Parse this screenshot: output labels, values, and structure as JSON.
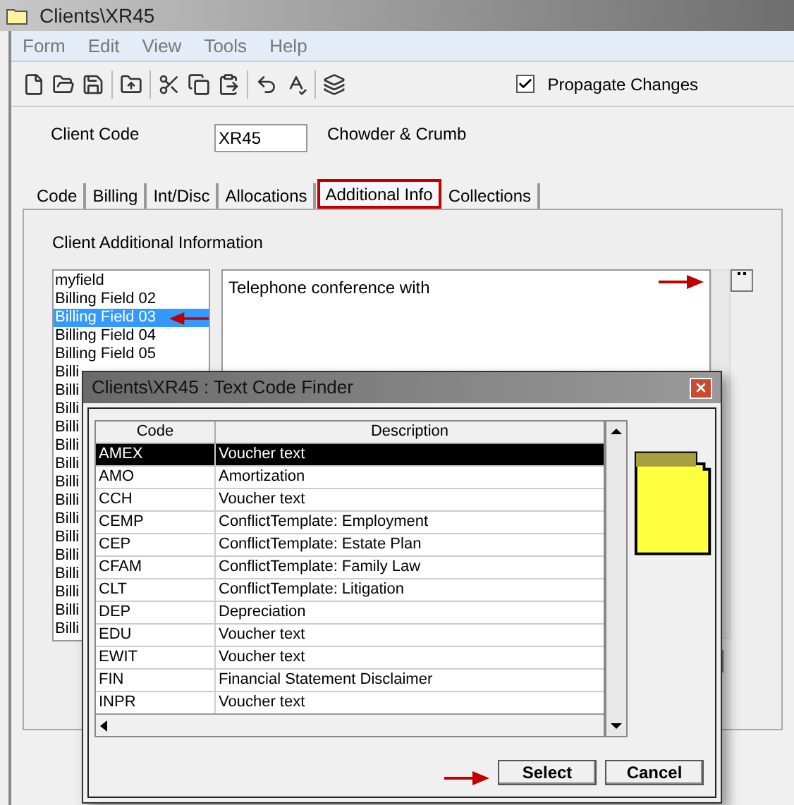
{
  "window": {
    "title": "Clients\\XR45"
  },
  "menu": [
    "Form",
    "Edit",
    "View",
    "Tools",
    "Help"
  ],
  "propagate": {
    "label": "Propagate Changes",
    "checked": true
  },
  "client": {
    "label": "Client Code",
    "code": "XR45",
    "name": "Chowder & Crumb"
  },
  "tabs": [
    {
      "label": "Code",
      "selected": false,
      "highlighted": false
    },
    {
      "label": "Billing",
      "selected": false,
      "highlighted": false
    },
    {
      "label": "Int/Disc",
      "selected": false,
      "highlighted": false
    },
    {
      "label": "Allocations",
      "selected": false,
      "highlighted": false
    },
    {
      "label": "Additional Info",
      "selected": true,
      "highlighted": true
    },
    {
      "label": "Collections",
      "selected": false,
      "highlighted": false
    }
  ],
  "section_title": "Client Additional Information",
  "fields": [
    {
      "label": "myfield",
      "selected": false
    },
    {
      "label": "Billing Field 02",
      "selected": false
    },
    {
      "label": "Billing Field 03",
      "selected": true
    },
    {
      "label": "Billing Field 04",
      "selected": false
    },
    {
      "label": "Billing Field 05",
      "selected": false
    },
    {
      "label": "Billi",
      "selected": false
    },
    {
      "label": "Billi",
      "selected": false
    },
    {
      "label": "Billi",
      "selected": false
    },
    {
      "label": "Billi",
      "selected": false
    },
    {
      "label": "Billi",
      "selected": false
    },
    {
      "label": "Billi",
      "selected": false
    },
    {
      "label": "Billi",
      "selected": false
    },
    {
      "label": "Billi",
      "selected": false
    },
    {
      "label": "Billi",
      "selected": false
    },
    {
      "label": "Billi",
      "selected": false
    },
    {
      "label": "Billi",
      "selected": false
    },
    {
      "label": "Billi",
      "selected": false
    },
    {
      "label": "Billi",
      "selected": false
    },
    {
      "label": "Billi",
      "selected": false
    },
    {
      "label": "Billi",
      "selected": false
    }
  ],
  "field_value": "Telephone conference with",
  "dialog": {
    "title": "Clients\\XR45 : Text Code Finder",
    "columns": [
      "Code",
      "Description"
    ],
    "rows": [
      {
        "code": "AMEX",
        "description": "Voucher text",
        "selected": true
      },
      {
        "code": "AMO",
        "description": "Amortization",
        "selected": false
      },
      {
        "code": "CCH",
        "description": "Voucher text",
        "selected": false
      },
      {
        "code": "CEMP",
        "description": "ConflictTemplate: Employment",
        "selected": false
      },
      {
        "code": "CEP",
        "description": "ConflictTemplate: Estate Plan",
        "selected": false
      },
      {
        "code": "CFAM",
        "description": "ConflictTemplate: Family Law",
        "selected": false
      },
      {
        "code": "CLT",
        "description": "ConflictTemplate: Litigation",
        "selected": false
      },
      {
        "code": "DEP",
        "description": "Depreciation",
        "selected": false
      },
      {
        "code": "EDU",
        "description": "Voucher text",
        "selected": false
      },
      {
        "code": "EWIT",
        "description": "Voucher text",
        "selected": false
      },
      {
        "code": "FIN",
        "description": "Financial Statement Disclaimer",
        "selected": false
      },
      {
        "code": "INPR",
        "description": "Voucher text",
        "selected": false
      }
    ],
    "buttons": [
      "Select",
      "Cancel"
    ]
  }
}
